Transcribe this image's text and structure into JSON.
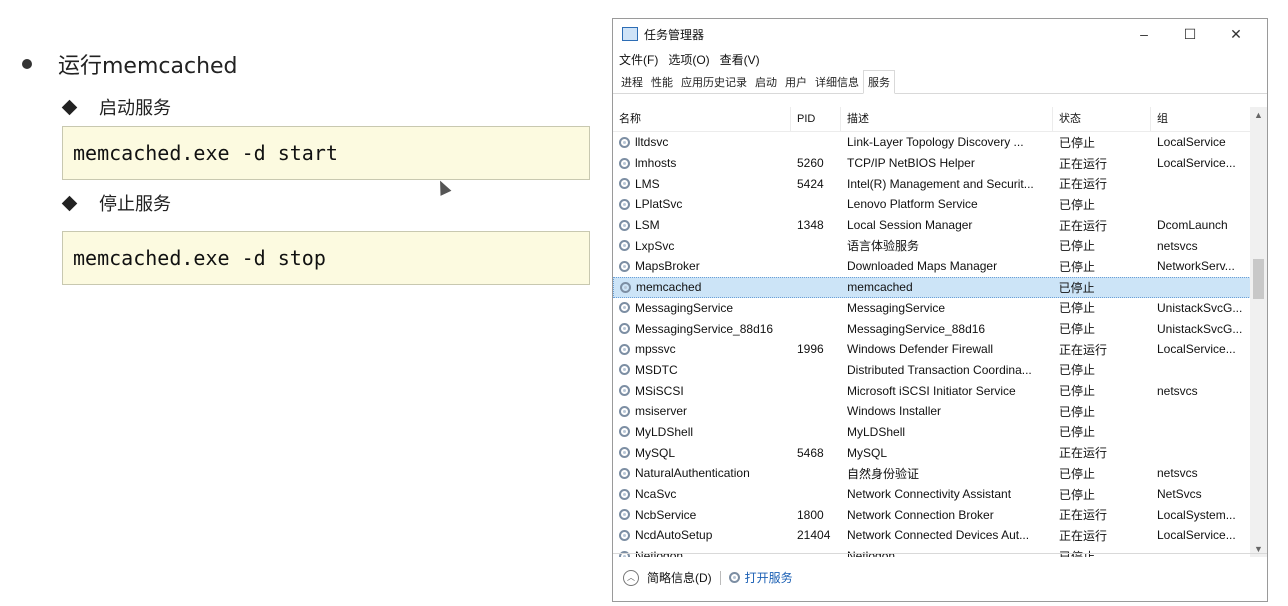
{
  "slide": {
    "bullet": "运行memcached",
    "start_label": "启动服务",
    "start_cmd": "memcached.exe -d start",
    "stop_label": "停止服务",
    "stop_cmd": "memcached.exe -d stop"
  },
  "taskmanager": {
    "title": "任务管理器",
    "window_controls": {
      "minimize": "–",
      "maximize": "☐",
      "close": "✕"
    },
    "menu": [
      "文件(F)",
      "选项(O)",
      "查看(V)"
    ],
    "tabs": [
      "进程",
      "性能",
      "应用历史记录",
      "启动",
      "用户",
      "详细信息",
      "服务"
    ],
    "active_tab": "服务",
    "columns": [
      "名称",
      "PID",
      "描述",
      "状态",
      "组"
    ],
    "rows": [
      {
        "name": "lltdsvc",
        "pid": "",
        "desc": "Link-Layer Topology Discovery ...",
        "state": "已停止",
        "group": "LocalService"
      },
      {
        "name": "lmhosts",
        "pid": "5260",
        "desc": "TCP/IP NetBIOS Helper",
        "state": "正在运行",
        "group": "LocalService..."
      },
      {
        "name": "LMS",
        "pid": "5424",
        "desc": "Intel(R) Management and Securit...",
        "state": "正在运行",
        "group": ""
      },
      {
        "name": "LPlatSvc",
        "pid": "",
        "desc": "Lenovo Platform Service",
        "state": "已停止",
        "group": ""
      },
      {
        "name": "LSM",
        "pid": "1348",
        "desc": "Local Session Manager",
        "state": "正在运行",
        "group": "DcomLaunch"
      },
      {
        "name": "LxpSvc",
        "pid": "",
        "desc": "语言体验服务",
        "state": "已停止",
        "group": "netsvcs"
      },
      {
        "name": "MapsBroker",
        "pid": "",
        "desc": "Downloaded Maps Manager",
        "state": "已停止",
        "group": "NetworkServ..."
      },
      {
        "name": "memcached",
        "pid": "",
        "desc": "memcached",
        "state": "已停止",
        "group": "",
        "selected": true
      },
      {
        "name": "MessagingService",
        "pid": "",
        "desc": "MessagingService",
        "state": "已停止",
        "group": "UnistackSvcG..."
      },
      {
        "name": "MessagingService_88d16",
        "pid": "",
        "desc": "MessagingService_88d16",
        "state": "已停止",
        "group": "UnistackSvcG..."
      },
      {
        "name": "mpssvc",
        "pid": "1996",
        "desc": "Windows Defender Firewall",
        "state": "正在运行",
        "group": "LocalService..."
      },
      {
        "name": "MSDTC",
        "pid": "",
        "desc": "Distributed Transaction Coordina...",
        "state": "已停止",
        "group": ""
      },
      {
        "name": "MSiSCSI",
        "pid": "",
        "desc": "Microsoft iSCSI Initiator Service",
        "state": "已停止",
        "group": "netsvcs"
      },
      {
        "name": "msiserver",
        "pid": "",
        "desc": "Windows Installer",
        "state": "已停止",
        "group": ""
      },
      {
        "name": "MyLDShell",
        "pid": "",
        "desc": "MyLDShell",
        "state": "已停止",
        "group": ""
      },
      {
        "name": "MySQL",
        "pid": "5468",
        "desc": "MySQL",
        "state": "正在运行",
        "group": ""
      },
      {
        "name": "NaturalAuthentication",
        "pid": "",
        "desc": "自然身份验证",
        "state": "已停止",
        "group": "netsvcs"
      },
      {
        "name": "NcaSvc",
        "pid": "",
        "desc": "Network Connectivity Assistant",
        "state": "已停止",
        "group": "NetSvcs"
      },
      {
        "name": "NcbService",
        "pid": "1800",
        "desc": "Network Connection Broker",
        "state": "正在运行",
        "group": "LocalSystem..."
      },
      {
        "name": "NcdAutoSetup",
        "pid": "21404",
        "desc": "Network Connected Devices Aut...",
        "state": "正在运行",
        "group": "LocalService..."
      },
      {
        "name": "Netlogon",
        "pid": "",
        "desc": "Netlogon",
        "state": "已停止",
        "group": ""
      }
    ],
    "footer": {
      "brief": "简略信息(D)",
      "open_services": "打开服务"
    }
  }
}
